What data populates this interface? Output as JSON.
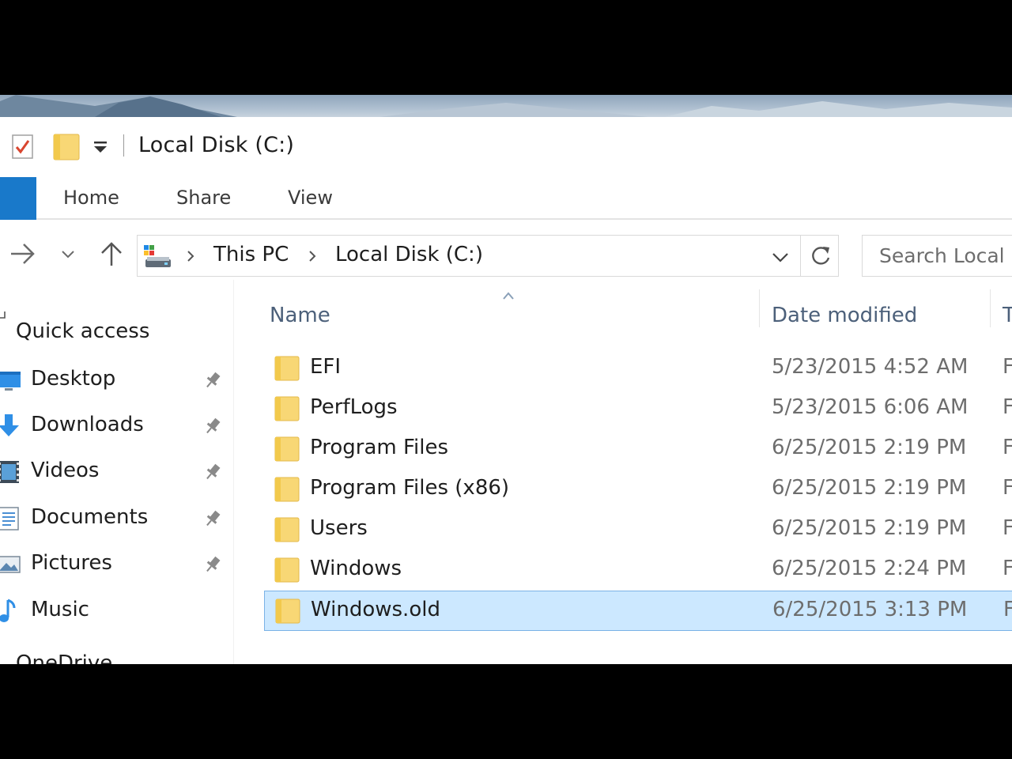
{
  "window": {
    "title": "Local Disk (C:)"
  },
  "ribbon": {
    "tabs": [
      {
        "label": "Home"
      },
      {
        "label": "Share"
      },
      {
        "label": "View"
      }
    ]
  },
  "address": {
    "crumbs": [
      {
        "label": "This PC"
      },
      {
        "label": "Local Disk (C:)"
      }
    ]
  },
  "search": {
    "placeholder": "Search Local Disk (C:)"
  },
  "navpane": {
    "quick_access_label": "Quick access",
    "items": [
      {
        "label": "Desktop",
        "icon": "desktop-icon",
        "pinned": true
      },
      {
        "label": "Downloads",
        "icon": "downloads-icon",
        "pinned": true
      },
      {
        "label": "Videos",
        "icon": "videos-icon",
        "pinned": true
      },
      {
        "label": "Documents",
        "icon": "documents-icon",
        "pinned": true
      },
      {
        "label": "Pictures",
        "icon": "pictures-icon",
        "pinned": true
      },
      {
        "label": "Music",
        "icon": "music-icon",
        "pinned": false
      }
    ],
    "next_item_peek": "OneDrive"
  },
  "filelist": {
    "columns": {
      "name": "Name",
      "date": "Date modified",
      "type": "T"
    },
    "rows": [
      {
        "name": "EFI",
        "date": "5/23/2015 4:52 AM",
        "type": "F",
        "selected": false
      },
      {
        "name": "PerfLogs",
        "date": "5/23/2015 6:06 AM",
        "type": "F",
        "selected": false
      },
      {
        "name": "Program Files",
        "date": "6/25/2015 2:19 PM",
        "type": "F",
        "selected": false
      },
      {
        "name": "Program Files (x86)",
        "date": "6/25/2015 2:19 PM",
        "type": "F",
        "selected": false
      },
      {
        "name": "Users",
        "date": "6/25/2015 2:19 PM",
        "type": "F",
        "selected": false
      },
      {
        "name": "Windows",
        "date": "6/25/2015 2:24 PM",
        "type": "F",
        "selected": false
      },
      {
        "name": "Windows.old",
        "date": "6/25/2015 3:13 PM",
        "type": "F",
        "selected": true
      }
    ]
  },
  "colors": {
    "accent": "#1979ca",
    "selection_fill": "#cce8ff",
    "selection_border": "#7ab2e6",
    "folder": "#f8d775",
    "header_text": "#4c607a"
  }
}
